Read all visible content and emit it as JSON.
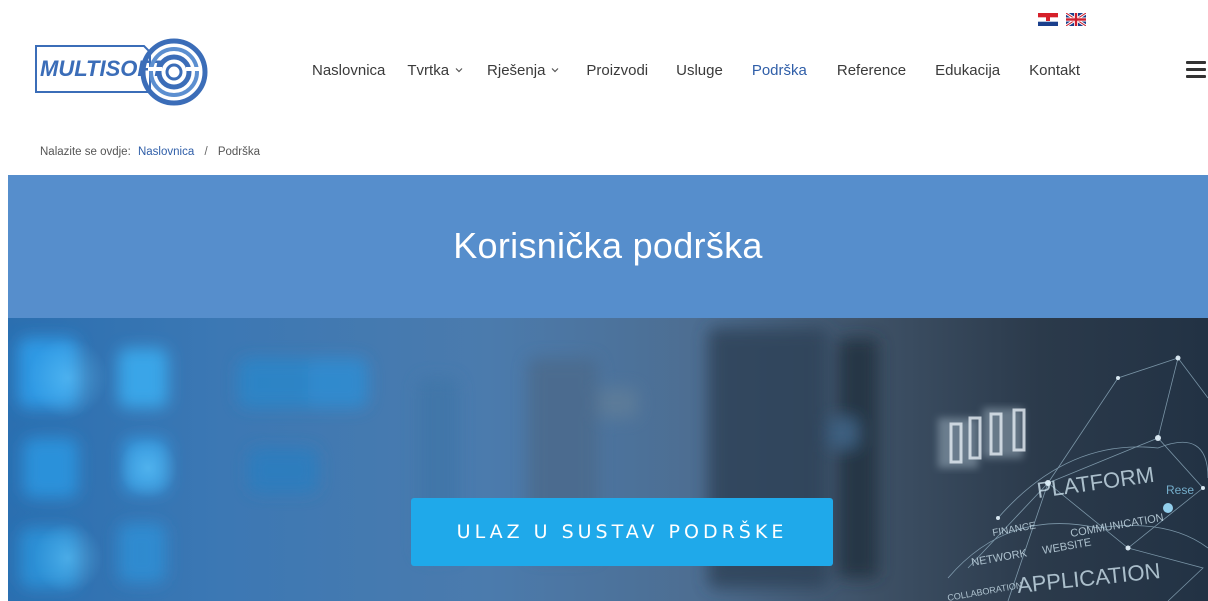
{
  "logo": {
    "text": "MULTISOFT"
  },
  "languages": [
    {
      "name": "Hrvatski",
      "icon": "croatia-flag-icon"
    },
    {
      "name": "English",
      "icon": "uk-flag-icon"
    }
  ],
  "nav": {
    "items": [
      {
        "label": "Naslovnica",
        "dropdown": false,
        "active": false
      },
      {
        "label": "Tvrtka",
        "dropdown": true,
        "active": false
      },
      {
        "label": "Rješenja",
        "dropdown": true,
        "active": false
      },
      {
        "label": "Proizvodi",
        "dropdown": false,
        "active": false
      },
      {
        "label": "Usluge",
        "dropdown": false,
        "active": false
      },
      {
        "label": "Podrška",
        "dropdown": false,
        "active": true
      },
      {
        "label": "Reference",
        "dropdown": false,
        "active": false
      },
      {
        "label": "Edukacija",
        "dropdown": false,
        "active": false
      },
      {
        "label": "Kontakt",
        "dropdown": false,
        "active": false
      }
    ],
    "menu_icon": "hamburger-menu-icon"
  },
  "breadcrumb": {
    "prefix": "Nalazite se ovdje:",
    "home": "Naslovnica",
    "separator": "/",
    "current": "Podrška"
  },
  "page": {
    "title": "Korisnička podrška",
    "cta_label": "ULAZ U SUSTAV PODRŠKE"
  },
  "hero_text": {
    "platform": "PLATFORM",
    "communication": "COMMUNICATION",
    "finance": "FINANCE",
    "network": "NETWORK",
    "website": "WEBSITE",
    "application": "APPLICATION",
    "collaboration": "COLLABORATION",
    "research": "Rese"
  },
  "colors": {
    "title_band": "#568ecc",
    "cta": "#1fa9ea",
    "active_nav": "#2f5ea8",
    "logo_blue": "#3b6db8"
  }
}
